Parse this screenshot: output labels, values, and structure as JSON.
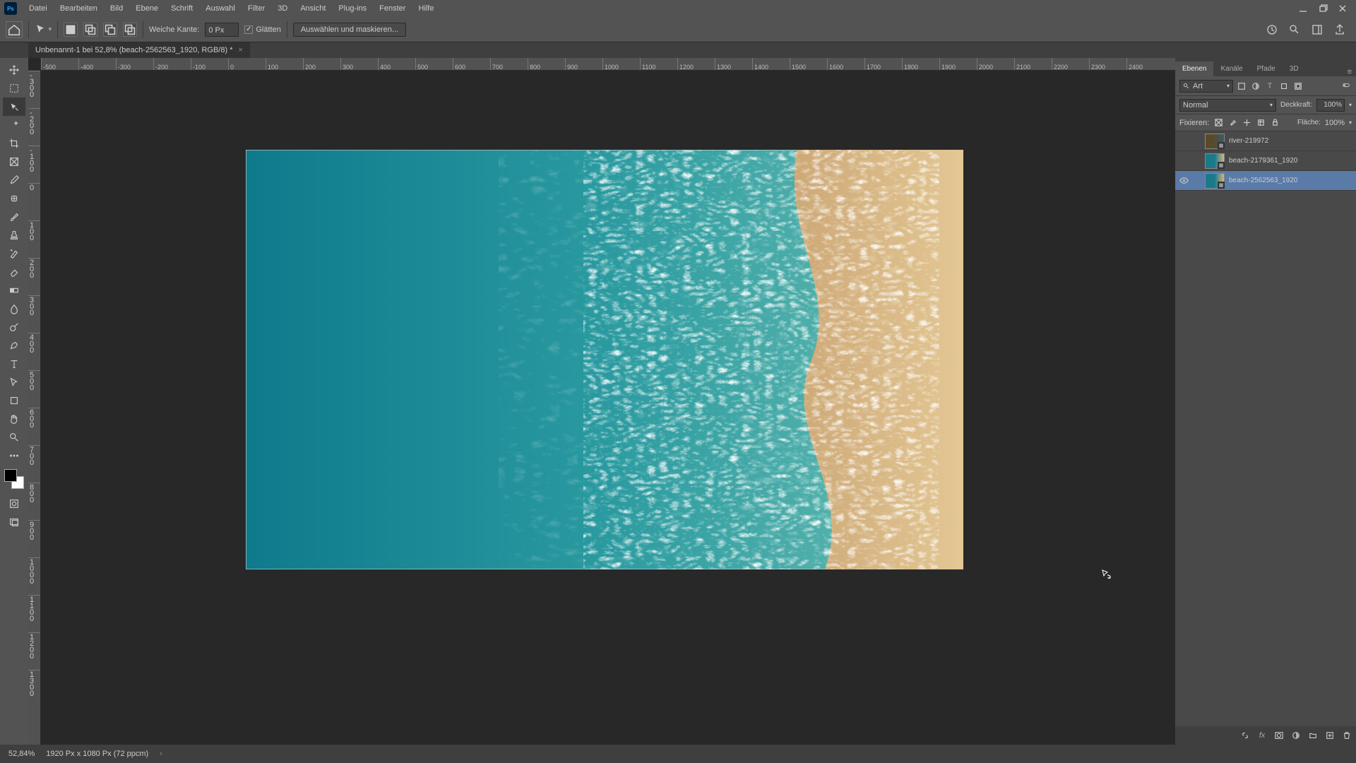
{
  "app": {
    "logo": "Ps"
  },
  "menu": [
    "Datei",
    "Bearbeiten",
    "Bild",
    "Ebene",
    "Schrift",
    "Auswahl",
    "Filter",
    "3D",
    "Ansicht",
    "Plug-ins",
    "Fenster",
    "Hilfe"
  ],
  "options": {
    "weiche_kante_label": "Weiche Kante:",
    "weiche_kante_value": "0 Px",
    "glaetten_label": "Glätten",
    "glaetten_checked": true,
    "select_mask": "Auswählen und maskieren..."
  },
  "doc_tab": {
    "title": "Unbenannt-1 bei 52,8% (beach-2562563_1920, RGB/8) *"
  },
  "ruler_h": [
    "-500",
    "-400",
    "-300",
    "-200",
    "-100",
    "0",
    "100",
    "200",
    "300",
    "400",
    "500",
    "600",
    "700",
    "800",
    "900",
    "1000",
    "1100",
    "1200",
    "1300",
    "1400",
    "1500",
    "1600",
    "1700",
    "1800",
    "1900",
    "2000",
    "2100",
    "2200",
    "2300",
    "2400"
  ],
  "ruler_v": [
    "-300",
    "-200",
    "-100",
    "0",
    "100",
    "200",
    "300",
    "400",
    "500",
    "600",
    "700",
    "800",
    "900",
    "1000",
    "1100",
    "1200",
    "1300"
  ],
  "panels": {
    "tabs": [
      "Ebenen",
      "Kanäle",
      "Pfade",
      "3D"
    ],
    "active_tab": 0,
    "filter_label": "Art",
    "blend_mode": "Normal",
    "opacity_label": "Deckkraft:",
    "opacity_value": "100%",
    "lock_label": "Fixieren:",
    "fill_label": "Fläche:",
    "fill_value": "100%",
    "layers": [
      {
        "name": "river-219972",
        "visible": false,
        "selected": false,
        "thumb": 0
      },
      {
        "name": "beach-2179361_1920",
        "visible": false,
        "selected": false,
        "thumb": 1
      },
      {
        "name": "beach-2562563_1920",
        "visible": true,
        "selected": true,
        "thumb": 2
      }
    ]
  },
  "status": {
    "zoom": "52,84%",
    "doc": "1920 Px x 1080 Px (72 ppcm)"
  }
}
